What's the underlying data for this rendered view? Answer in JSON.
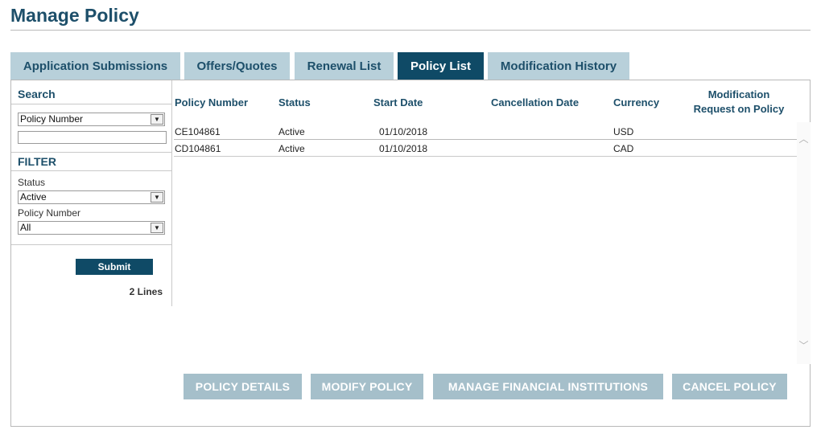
{
  "page": {
    "title": "Manage Policy"
  },
  "tabs": [
    {
      "label": "Application Submissions",
      "active": false
    },
    {
      "label": "Offers/Quotes",
      "active": false
    },
    {
      "label": "Renewal List",
      "active": false
    },
    {
      "label": "Policy List",
      "active": true
    },
    {
      "label": "Modification History",
      "active": false
    }
  ],
  "colors": {
    "brand_dark": "#0f4a66",
    "tab_inactive": "#b8d0da",
    "action_button": "#a5bfca"
  },
  "sidebar": {
    "search_heading": "Search",
    "search_by": {
      "value": "Policy Number"
    },
    "search_text": {
      "value": "",
      "placeholder": ""
    },
    "filter_heading": "FILTER",
    "status_label": "Status",
    "status": {
      "value": "Active"
    },
    "policy_number_label": "Policy Number",
    "policy_number": {
      "value": "All"
    },
    "submit_label": "Submit",
    "lines_count": "2 Lines"
  },
  "table": {
    "columns": [
      "Policy Number",
      "Status",
      "Start Date",
      "Cancellation Date",
      "Currency",
      "Modification",
      "Request on Policy"
    ],
    "rows": [
      {
        "policy_number": "CE104861",
        "status": "Active",
        "start_date": "01/10/2018",
        "cancellation_date": "",
        "currency": "USD",
        "modification_request": ""
      },
      {
        "policy_number": "CD104861",
        "status": "Active",
        "start_date": "01/10/2018",
        "cancellation_date": "",
        "currency": "CAD",
        "modification_request": ""
      }
    ]
  },
  "actions": {
    "policy_details": "POLICY DETAILS",
    "modify_policy": "MODIFY POLICY",
    "manage_financial_institutions": "MANAGE FINANCIAL INSTITUTIONS",
    "cancel_policy": "CANCEL POLICY"
  },
  "icons": {
    "dropdown": "chevron-down-icon",
    "scroll_up": "chevron-up-icon",
    "scroll_down": "chevron-down-icon"
  }
}
